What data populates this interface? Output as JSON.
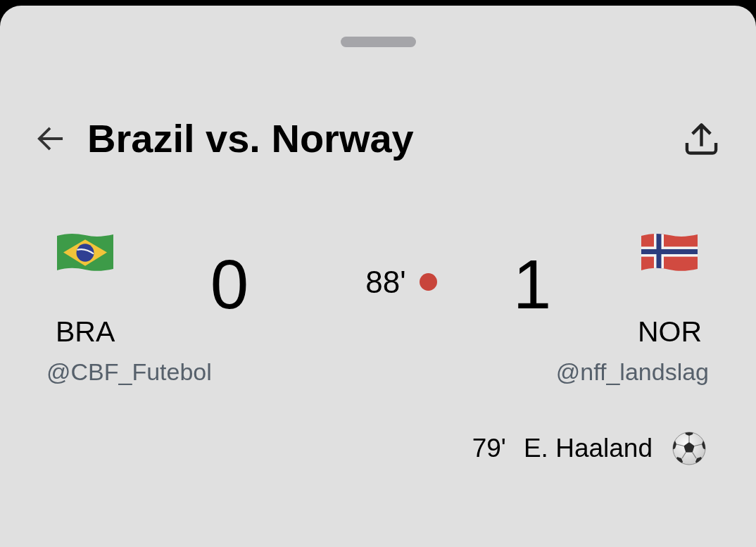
{
  "header": {
    "title": "Brazil vs. Norway"
  },
  "teams": [
    {
      "kind": "brazil",
      "code": "BRA",
      "score": "0",
      "handle": "@CBF_Futebol"
    },
    {
      "kind": "norway",
      "code": "NOR",
      "score": "1",
      "handle": "@nff_landslag"
    }
  ],
  "match": {
    "clock": "88'",
    "live": true
  },
  "events": [
    {
      "kind": "goal",
      "minute": "79'",
      "player": "E. Haaland"
    }
  ]
}
